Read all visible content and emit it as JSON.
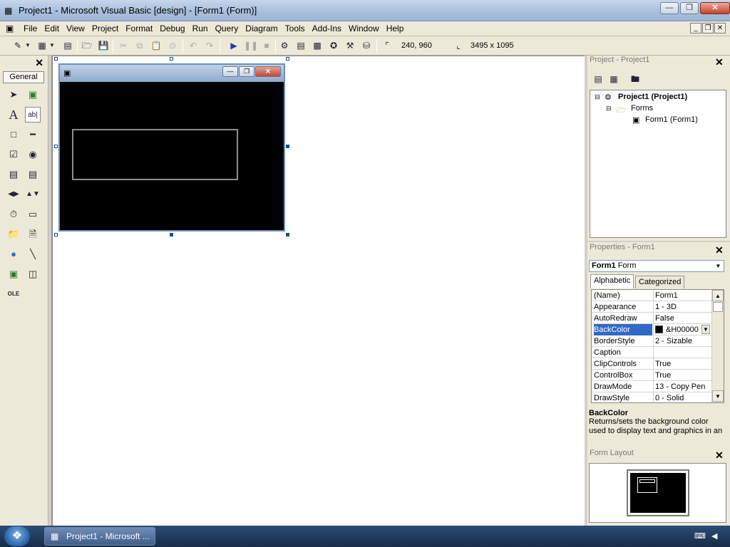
{
  "window": {
    "title": "Project1 - Microsoft Visual Basic [design] - [Form1 (Form)]"
  },
  "menu": [
    "File",
    "Edit",
    "View",
    "Project",
    "Format",
    "Debug",
    "Run",
    "Query",
    "Diagram",
    "Tools",
    "Add-Ins",
    "Window",
    "Help"
  ],
  "toolbar": {
    "position": "240, 960",
    "size": "3495 x 1095"
  },
  "toolbox": {
    "tab_label": "General"
  },
  "project": {
    "title": "Project - Project1",
    "tree": {
      "root": "Project1 (Project1)",
      "folder": "Forms",
      "item": "Form1 (Form1)"
    }
  },
  "properties": {
    "title": "Properties - Form1",
    "object_name": "Form1",
    "object_type": "Form",
    "tabs": [
      "Alphabetic",
      "Categorized"
    ],
    "rows": [
      {
        "name": "(Name)",
        "value": "Form1"
      },
      {
        "name": "Appearance",
        "value": "1 - 3D"
      },
      {
        "name": "AutoRedraw",
        "value": "False"
      },
      {
        "name": "BackColor",
        "value": "&H00000",
        "swatch": "#000000"
      },
      {
        "name": "BorderStyle",
        "value": "2 - Sizable"
      },
      {
        "name": "Caption",
        "value": ""
      },
      {
        "name": "ClipControls",
        "value": "True"
      },
      {
        "name": "ControlBox",
        "value": "True"
      },
      {
        "name": "DrawMode",
        "value": "13 - Copy Pen"
      },
      {
        "name": "DrawStyle",
        "value": "0 - Solid"
      }
    ],
    "selected_property": "BackColor",
    "description": "Returns/sets the background color used to display text and graphics in an"
  },
  "layout": {
    "title": "Form Layout"
  },
  "taskbar": {
    "task_label": "Project1 - Microsoft ..."
  },
  "colors": {
    "selection": "#316ac5",
    "form_back": "#000000"
  }
}
